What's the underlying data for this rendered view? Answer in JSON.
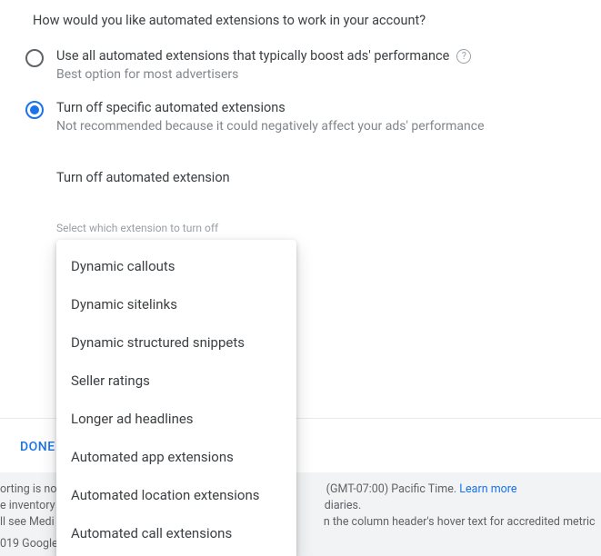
{
  "question": "How would you like automated extensions to work in your account?",
  "option1": {
    "label": "Use all automated extensions that typically boost ads' performance",
    "sub": "Best option for most advertisers"
  },
  "option2": {
    "label": "Turn off specific automated extensions",
    "sub": "Not recommended because it could negatively affect your ads' performance"
  },
  "section_heading": "Turn off automated extension",
  "select_label": "Select which extension to turn off",
  "dropdown": {
    "items": [
      "Dynamic callouts",
      "Dynamic sitelinks",
      "Dynamic structured snippets",
      "Seller ratings",
      "Longer ad headlines",
      "Automated app extensions",
      "Automated location extensions",
      "Automated call extensions"
    ]
  },
  "done_label": "DONE",
  "help_glyph": "?",
  "bottom": {
    "line1_left": "orting is no",
    "line1_right": " (GMT-07:00) Pacific Time. ",
    "learn_more": "Learn more",
    "line2_left": "e inventory ",
    "line2_right": "diaries.",
    "line3_left": "ll see Medi",
    "line3_right": "n the column header's hover text for accredited metrics.",
    "line4": "019 Google"
  }
}
